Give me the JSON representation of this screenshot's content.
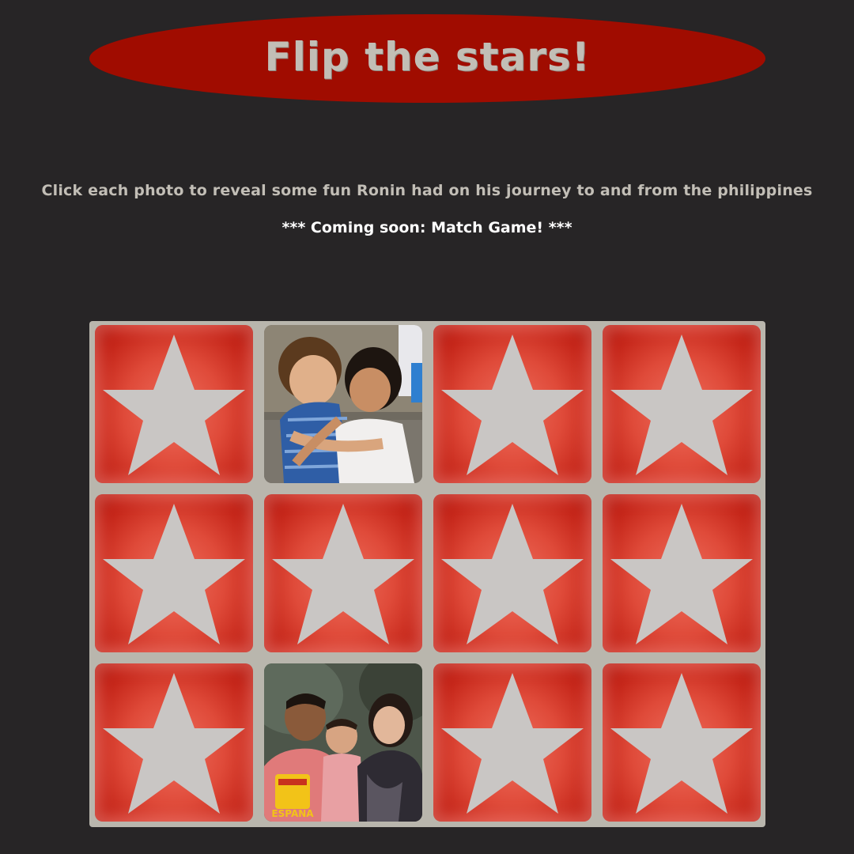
{
  "header": {
    "title": "Flip the stars!"
  },
  "intro": {
    "instructions": "Click each photo to reveal some fun Ronin had on his journey to and from the philippines",
    "coming_soon": "*** Coming soon: Match Game! ***"
  },
  "board": {
    "rows": 3,
    "columns": 4,
    "cards": [
      {
        "state": "star",
        "icon": "star-icon"
      },
      {
        "state": "photo",
        "photo": "two-kids-hugging-photo"
      },
      {
        "state": "star",
        "icon": "star-icon"
      },
      {
        "state": "star",
        "icon": "star-icon"
      },
      {
        "state": "star",
        "icon": "star-icon"
      },
      {
        "state": "star",
        "icon": "star-icon"
      },
      {
        "state": "star",
        "icon": "star-icon"
      },
      {
        "state": "star",
        "icon": "star-icon"
      },
      {
        "state": "star",
        "icon": "star-icon"
      },
      {
        "state": "photo",
        "photo": "family-portrait-photo",
        "shirt_text": "ESPAÑA"
      },
      {
        "state": "star",
        "icon": "star-icon"
      },
      {
        "state": "star",
        "icon": "star-icon"
      }
    ]
  },
  "colors": {
    "background": "#272526",
    "title_oval": "#a00c00",
    "title_text": "#c2beb6",
    "board": "#b9b6ad",
    "card_red": "#d8392a",
    "star": "#c9c6c4"
  }
}
